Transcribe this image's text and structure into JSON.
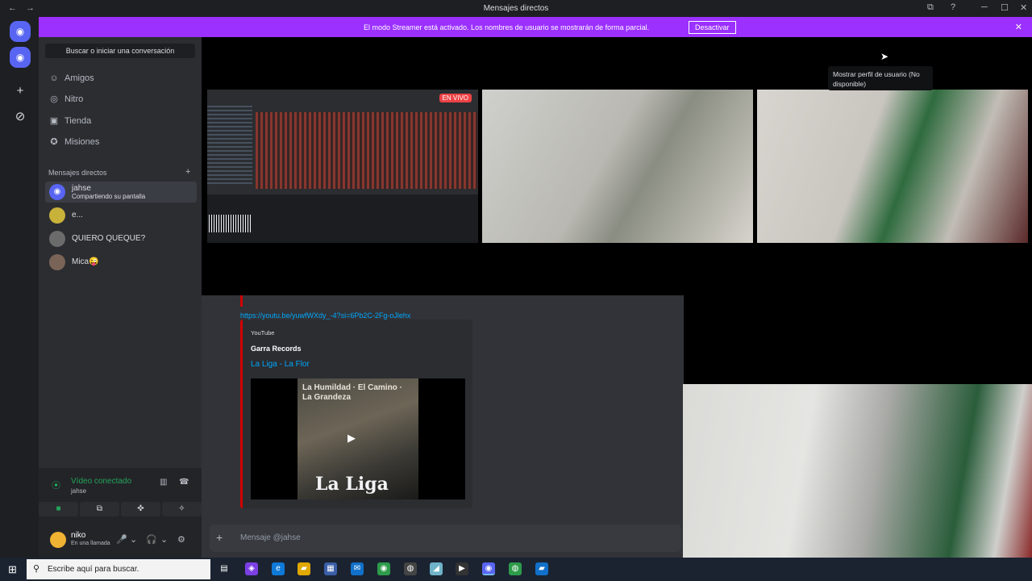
{
  "window": {
    "title": "Mensajes directos",
    "nav_arrows": "← →",
    "controls": [
      "⧉",
      "?",
      "─",
      "☐",
      "✕"
    ]
  },
  "banner": {
    "message": "El modo Streamer está activado. Los nombres de usuario se mostrarán de forma parcial.",
    "button": "Desactivar",
    "close": "✕"
  },
  "guilds": {
    "home": "◉",
    "add": "+",
    "explore": "⊘"
  },
  "sidebar": {
    "search_label": "Buscar o iniciar una conversación",
    "nav": [
      {
        "label": "Amigos",
        "icon": "friends-icon",
        "glyph": "☺"
      },
      {
        "label": "Nitro",
        "icon": "nitro-icon",
        "glyph": "◎"
      },
      {
        "label": "Tienda",
        "icon": "shop-icon",
        "glyph": "▣"
      },
      {
        "label": "Misiones",
        "icon": "quests-icon",
        "glyph": "✪"
      }
    ],
    "dm_header": "Mensajes directos",
    "dm_add": "+",
    "dms": [
      {
        "name": "jahse",
        "status": "Compartiendo su pantalla"
      },
      {
        "name": "e..."
      },
      {
        "name": "QUIERO QUEQUE?"
      },
      {
        "name": "Mica😜"
      }
    ]
  },
  "voice": {
    "status": "Vídeo conectado",
    "channel": "jahse",
    "signal": "⦿",
    "buttons": [
      "■",
      "⧉",
      "✜",
      "✧"
    ],
    "noise": "▥",
    "hangup": "☎"
  },
  "user": {
    "name": "niko",
    "status": "En una llamada",
    "controls": [
      "🎤",
      "⌄",
      "🎧",
      "⌄",
      "⚙"
    ]
  },
  "stream": {
    "live_badge": "EN VIVO",
    "tooltip": "Mostrar perfil de usuario (No disponible)"
  },
  "chat": {
    "link": "https://youtu.be/yuwfWXdy_-4?si=6Pb2C-2Fg-oJlehx",
    "embed": {
      "provider": "YouTube",
      "author": "Garra Records",
      "title": "La Liga - La Flor",
      "cover_top": "La Humildad · El Camino · La Grandeza",
      "cover_bottom": "La Liga",
      "play": "▶"
    },
    "composer_plus": "+",
    "composer_placeholder": "Mensaje @jahse"
  },
  "taskbar": {
    "start": "⊞",
    "search_placeholder": "Escribe aquí para buscar.",
    "search_icon": "⚲",
    "apps": [
      "▤",
      "◈",
      "e",
      "▰",
      "▦",
      "✉",
      "◉",
      "◍",
      "◢",
      "▶",
      "◉",
      "◍",
      "▰"
    ]
  }
}
